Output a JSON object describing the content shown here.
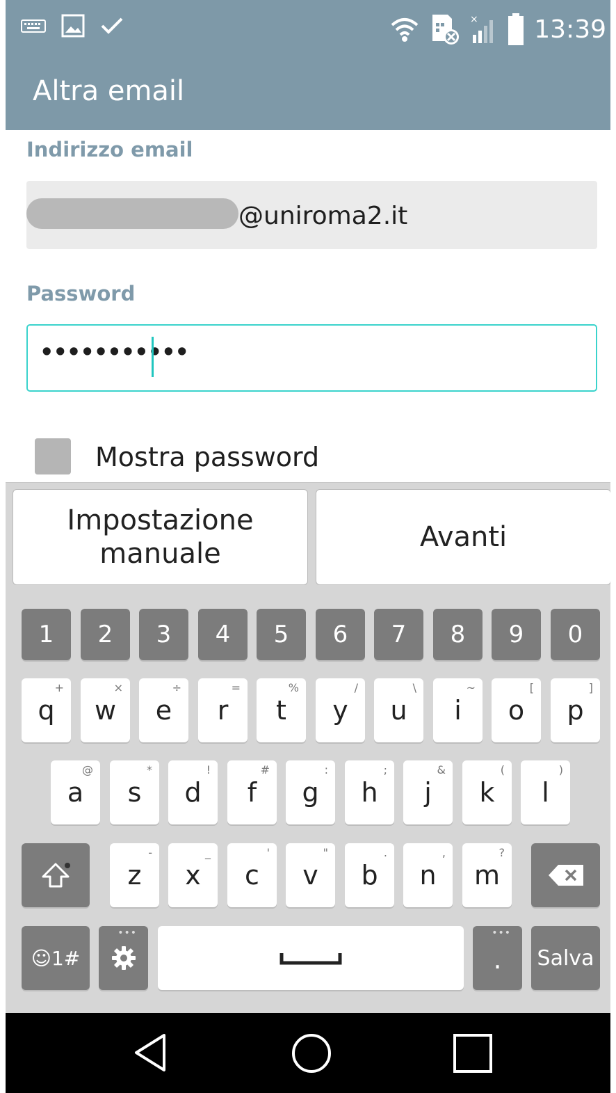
{
  "status_bar": {
    "time": "13:39",
    "icons_left": [
      "keyboard-icon",
      "image-icon",
      "check-icon"
    ],
    "icons_right": [
      "wifi-icon",
      "sim-error-icon",
      "signal-icon",
      "battery-icon"
    ]
  },
  "app_bar": {
    "title": "Altra email"
  },
  "form": {
    "email_label": "Indirizzo email",
    "email_value": "@uniroma2.it",
    "password_label": "Password",
    "password_value": "•••••••••••",
    "show_password_label": "Mostra password"
  },
  "suggestions": {
    "left": "Impostazione manuale",
    "right": "Avanti"
  },
  "keyboard": {
    "numbers": [
      "1",
      "2",
      "3",
      "4",
      "5",
      "6",
      "7",
      "8",
      "9",
      "0"
    ],
    "row1": [
      {
        "key": "q",
        "sub": "+"
      },
      {
        "key": "w",
        "sub": "×"
      },
      {
        "key": "e",
        "sub": "÷"
      },
      {
        "key": "r",
        "sub": "="
      },
      {
        "key": "t",
        "sub": "%"
      },
      {
        "key": "y",
        "sub": "/"
      },
      {
        "key": "u",
        "sub": "\\"
      },
      {
        "key": "i",
        "sub": "~"
      },
      {
        "key": "o",
        "sub": "["
      },
      {
        "key": "p",
        "sub": "]"
      }
    ],
    "row2": [
      {
        "key": "a",
        "sub": "@"
      },
      {
        "key": "s",
        "sub": "*"
      },
      {
        "key": "d",
        "sub": "!"
      },
      {
        "key": "f",
        "sub": "#"
      },
      {
        "key": "g",
        "sub": ":"
      },
      {
        "key": "h",
        "sub": ";"
      },
      {
        "key": "j",
        "sub": "&"
      },
      {
        "key": "k",
        "sub": "("
      },
      {
        "key": "l",
        "sub": ")"
      }
    ],
    "row3": [
      {
        "key": "z",
        "sub": "-"
      },
      {
        "key": "x",
        "sub": "_"
      },
      {
        "key": "c",
        "sub": "'"
      },
      {
        "key": "v",
        "sub": "\""
      },
      {
        "key": "b",
        "sub": "."
      },
      {
        "key": "n",
        "sub": ","
      },
      {
        "key": "m",
        "sub": "?"
      }
    ],
    "symbols_key": "☺1#",
    "period_key": ".",
    "enter_key": "Salva"
  },
  "nav_bar": {
    "icons": [
      "back-icon",
      "home-icon",
      "recents-icon"
    ]
  }
}
